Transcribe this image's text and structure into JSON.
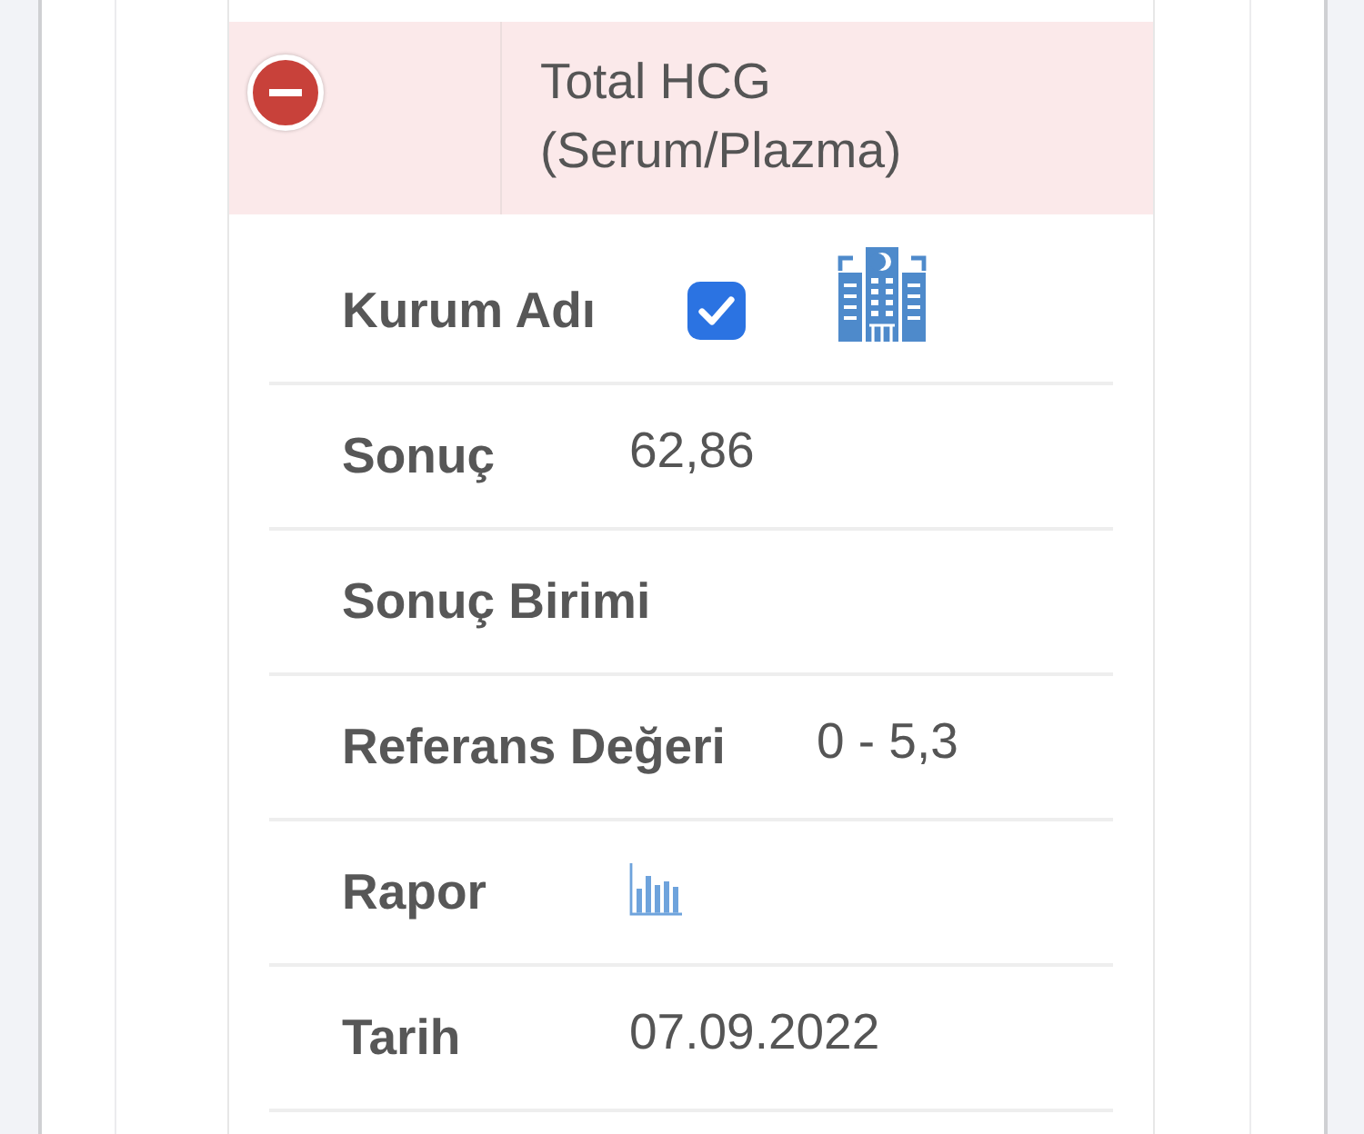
{
  "test": {
    "name": "Total HCG (Serum/Plazma)",
    "expanded": true
  },
  "details": [
    {
      "kind": "institution",
      "label": "Kurum Adı",
      "checked": true
    },
    {
      "kind": "text",
      "label": "Sonuç",
      "value": "62,86"
    },
    {
      "kind": "text",
      "label": "Sonuç Birimi"
    },
    {
      "kind": "text",
      "label": "Referans Değeri",
      "value": "0 - 5,3"
    },
    {
      "kind": "report",
      "label": "Rapor"
    },
    {
      "kind": "text",
      "label": "Tarih",
      "value": "07.09.2022"
    }
  ]
}
